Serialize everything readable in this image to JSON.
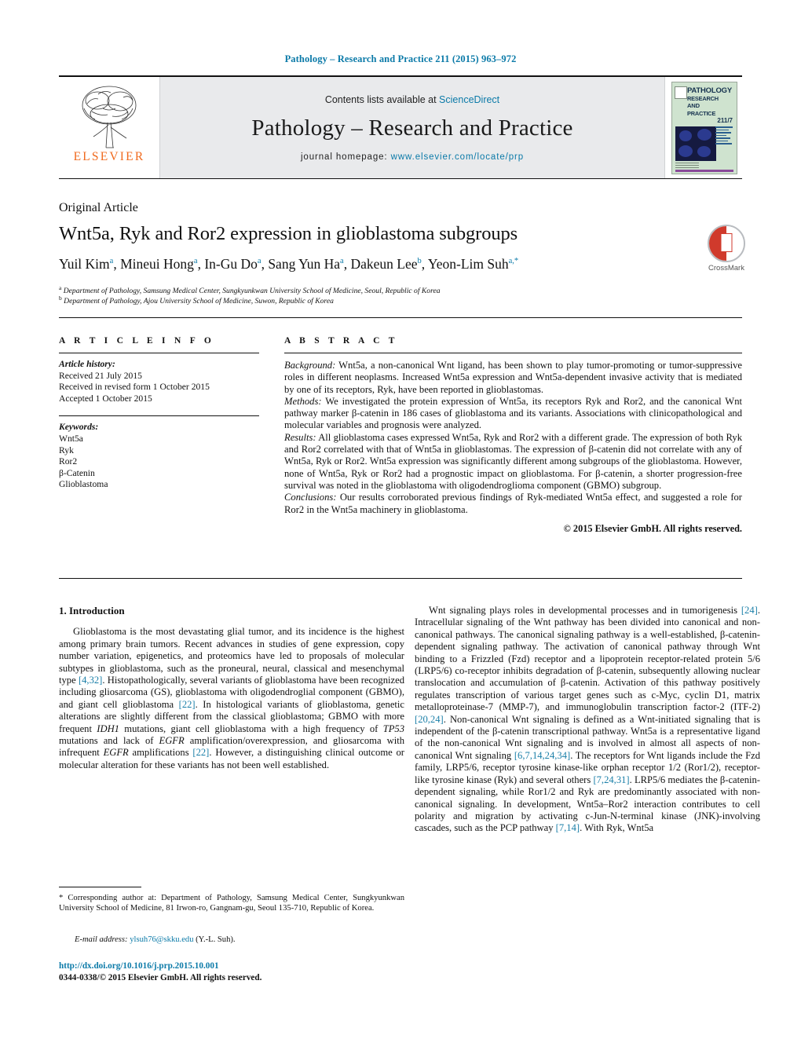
{
  "running_head": "Pathology – Research and Practice 211 (2015) 963–972",
  "masthead": {
    "contents_prefix": "Contents lists available at ",
    "contents_link": "ScienceDirect",
    "journal_name": "Pathology – Research and Practice",
    "homepage_prefix": "journal homepage: ",
    "homepage_link": "www.elsevier.com/locate/prp",
    "publisher_wordmark": "ELSEVIER",
    "cover": {
      "line1": "PATHOLOGY",
      "line2": "RESEARCH",
      "line3": "AND",
      "line4": "PRACTICE",
      "issue": "211/7"
    }
  },
  "article": {
    "type": "Original Article",
    "title": "Wnt5a, Ryk and Ror2 expression in glioblastoma subgroups",
    "authors": [
      {
        "name": "Yuil Kim",
        "sup": "a"
      },
      {
        "name": "Mineui Hong",
        "sup": "a"
      },
      {
        "name": "In-Gu Do",
        "sup": "a"
      },
      {
        "name": "Sang Yun Ha",
        "sup": "a"
      },
      {
        "name": "Dakeun Lee",
        "sup": "b"
      },
      {
        "name": "Yeon-Lim Suh",
        "sup": "a,*"
      }
    ],
    "affiliations": [
      {
        "mark": "a",
        "text": "Department of Pathology, Samsung Medical Center, Sungkyunkwan University School of Medicine, Seoul, Republic of Korea"
      },
      {
        "mark": "b",
        "text": "Department of Pathology, Ajou University School of Medicine, Suwon, Republic of Korea"
      }
    ],
    "crossmark_label": "CrossMark"
  },
  "info": {
    "heading": "A R T I C L E   I N F O",
    "history_title": "Article history:",
    "history": [
      "Received 21 July 2015",
      "Received in revised form 1 October 2015",
      "Accepted 1 October 2015"
    ],
    "keywords_title": "Keywords:",
    "keywords": [
      "Wnt5a",
      "Ryk",
      "Ror2",
      "β-Catenin",
      "Glioblastoma"
    ]
  },
  "abstract": {
    "heading": "A B S T R A C T",
    "background_label": "Background:",
    "background_text": " Wnt5a, a non-canonical Wnt ligand, has been shown to play tumor-promoting or tumor-suppressive roles in different neoplasms. Increased Wnt5a expression and Wnt5a-dependent invasive activity that is mediated by one of its receptors, Ryk, have been reported in glioblastomas.",
    "methods_label": "Methods:",
    "methods_text": " We investigated the protein expression of Wnt5a, its receptors Ryk and Ror2, and the canonical Wnt pathway marker β-catenin in 186 cases of glioblastoma and its variants. Associations with clinicopathological and molecular variables and prognosis were analyzed.",
    "results_label": "Results:",
    "results_text": " All glioblastoma cases expressed Wnt5a, Ryk and Ror2 with a different grade. The expression of both Ryk and Ror2 correlated with that of Wnt5a in glioblastomas. The expression of β-catenin did not correlate with any of Wnt5a, Ryk or Ror2. Wnt5a expression was significantly different among subgroups of the glioblastoma. However, none of Wnt5a, Ryk or Ror2 had a prognostic impact on glioblastoma. For β-catenin, a shorter progression-free survival was noted in the glioblastoma with oligodendroglioma component (GBMO) subgroup.",
    "conclusions_label": "Conclusions:",
    "conclusions_text": " Our results corroborated previous findings of Ryk-mediated Wnt5a effect, and suggested a role for Ror2 in the Wnt5a machinery in glioblastoma.",
    "copyright": "© 2015 Elsevier GmbH. All rights reserved."
  },
  "body": {
    "section_number": "1.",
    "section_title": "Introduction",
    "left_paragraph_parts": [
      "Glioblastoma is the most devastating glial tumor, and its incidence is the highest among primary brain tumors. Recent advances in studies of gene expression, copy number variation, epigenetics, and proteomics have led to proposals of molecular subtypes in glioblastoma, such as the proneural, neural, classical and mesenchymal type ",
      "[4,32]",
      ". Histopathologically, several variants of glioblastoma have been recognized including gliosarcoma (GS), glioblastoma with oligodendroglial component (GBMO), and giant cell glioblastoma ",
      "[22]",
      ". In histological variants of glioblastoma, genetic alterations are slightly different from the classical glioblastoma; GBMO with more frequent ",
      "IDH1",
      " mutations, giant cell glioblastoma with a high frequency of ",
      "TP53",
      " mutations and lack of ",
      "EGFR",
      " amplification/overexpression, and gliosarcoma with infrequent ",
      "EGFR",
      " amplifications ",
      "[22]",
      ". However, a distinguishing clinical outcome or molecular alteration for these variants has not been well established."
    ],
    "right_paragraph_parts": [
      "Wnt signaling plays roles in developmental processes and in tumorigenesis ",
      "[24]",
      ". Intracellular signaling of the Wnt pathway has been divided into canonical and non-canonical pathways. The canonical signaling pathway is a well-established, β-catenin-dependent signaling pathway. The activation of canonical pathway through Wnt binding to a Frizzled (Fzd) receptor and a lipoprotein receptor-related protein 5/6 (LRP5/6) co-receptor inhibits degradation of β-catenin, subsequently allowing nuclear translocation and accumulation of β-catenin. Activation of this pathway positively regulates transcription of various target genes such as c-Myc, cyclin D1, matrix metalloproteinase-7 (MMP-7), and immunoglobulin transcription factor-2 (ITF-2) ",
      "[20,24]",
      ". Non-canonical Wnt signaling is defined as a Wnt-initiated signaling that is independent of the β-catenin transcriptional pathway. Wnt5a is a representative ligand of the non-canonical Wnt signaling and is involved in almost all aspects of non-canonical Wnt signaling ",
      "[6,7,14,24,34]",
      ". The receptors for Wnt ligands include the Fzd family, LRP5/6, receptor tyrosine kinase-like orphan receptor 1/2 (Ror1/2), receptor-like tyrosine kinase (Ryk) and several others ",
      "[7,24,31]",
      ". LRP5/6 mediates the β-catenin-dependent signaling, while Ror1/2 and Ryk are predominantly associated with non-canonical signaling. In development, Wnt5a–Ror2 interaction contributes to cell polarity and migration by activating c-Jun-N-terminal kinase (JNK)-involving cascades, such as the PCP pathway ",
      "[7,14]",
      ". With Ryk, Wnt5a"
    ]
  },
  "footer": {
    "corresponding_star": "*",
    "corresponding_text": " Corresponding author at: Department of Pathology, Samsung Medical Center, Sungkyunkwan University School of Medicine, 81 Irwon-ro, Gangnam-gu, Seoul 135-710, Republic of Korea.",
    "email_label": "E-mail address:",
    "email_address": "ylsuh76@skku.edu",
    "email_suffix": " (Y.-L. Suh).",
    "doi": "http://dx.doi.org/10.1016/j.prp.2015.10.001",
    "issn_line": "0344-0338/© 2015 Elsevier GmbH. All rights reserved."
  }
}
